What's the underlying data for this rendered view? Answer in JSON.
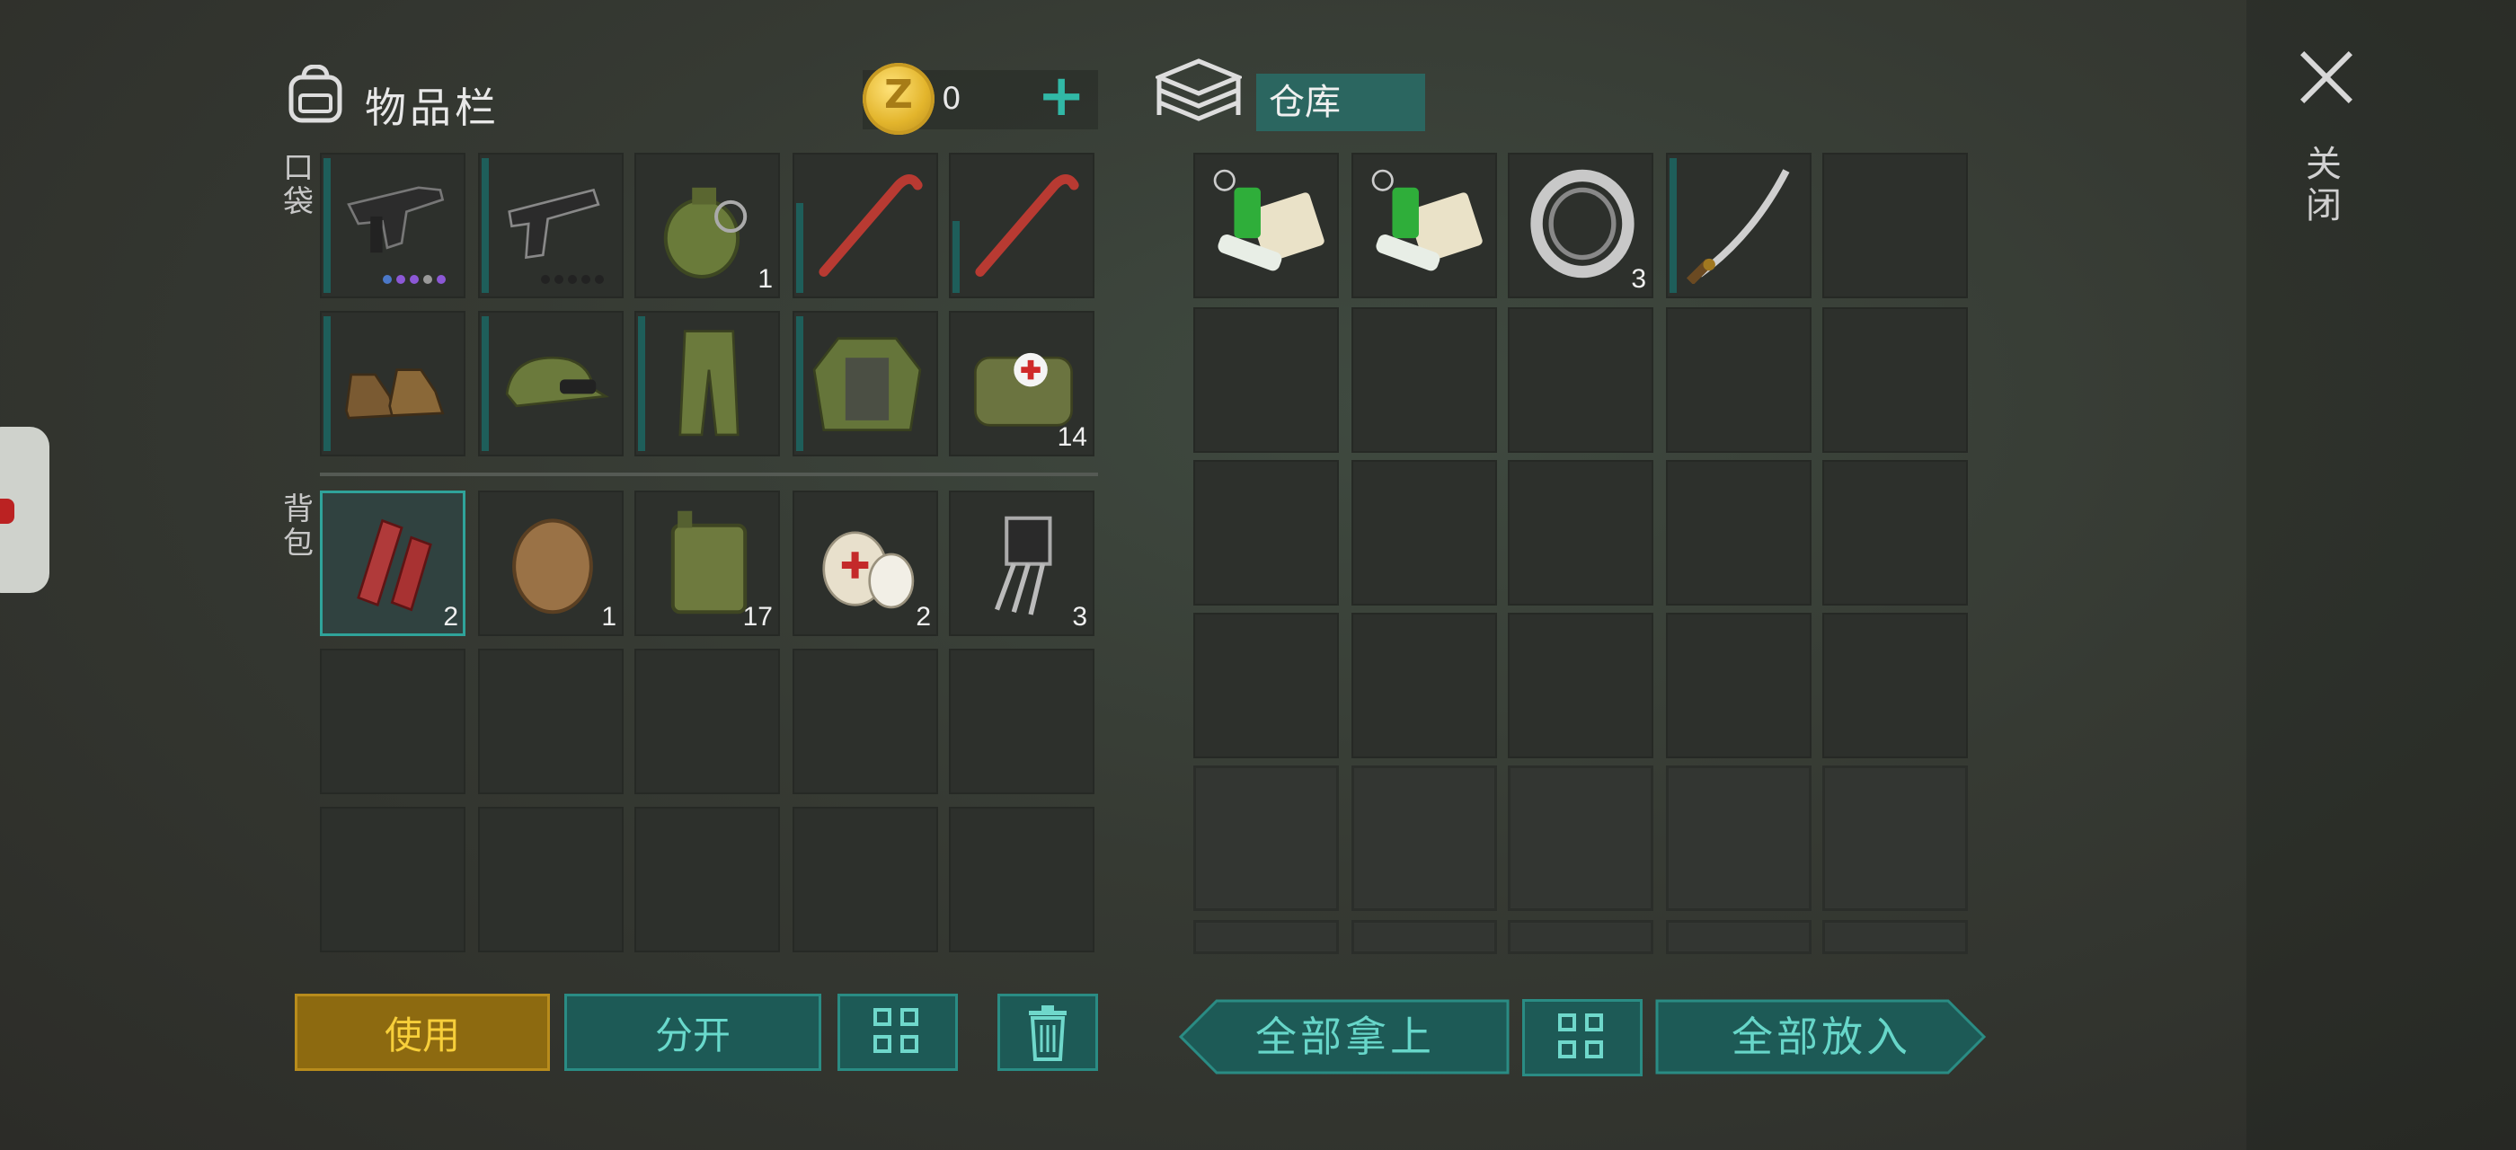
{
  "inventory": {
    "title": "物品栏",
    "coins": "0",
    "add_label": "+"
  },
  "sections": {
    "pockets": "口袋",
    "backpack": "背包"
  },
  "pocket_items": [
    {
      "name": "uzi",
      "qty": ""
    },
    {
      "name": "pistol",
      "qty": ""
    },
    {
      "name": "grenade",
      "qty": "1"
    },
    {
      "name": "crowbar",
      "qty": ""
    },
    {
      "name": "crowbar",
      "qty": ""
    },
    {
      "name": "boots",
      "qty": ""
    },
    {
      "name": "camo-cap",
      "qty": ""
    },
    {
      "name": "camo-pants",
      "qty": ""
    },
    {
      "name": "armored-jacket",
      "qty": ""
    },
    {
      "name": "medkit-bag",
      "qty": "14"
    }
  ],
  "backpack_items": [
    {
      "name": "raw-meat",
      "qty": "2"
    },
    {
      "name": "fur",
      "qty": "1"
    },
    {
      "name": "jerrycan",
      "qty": "17"
    },
    {
      "name": "bandage",
      "qty": "2"
    },
    {
      "name": "transistor",
      "qty": "3"
    }
  ],
  "storage": {
    "title": "仓库",
    "items": [
      {
        "name": "medicine-kit",
        "qty": ""
      },
      {
        "name": "medicine-kit",
        "qty": ""
      },
      {
        "name": "bearing",
        "qty": "3"
      },
      {
        "name": "katana",
        "qty": ""
      }
    ]
  },
  "buttons": {
    "use": "使用",
    "split": "分开",
    "take_all": "全部拿上",
    "put_all": "全部放入"
  },
  "close_label": "关闭",
  "colors": {
    "accent": "#2fa39a",
    "use_button": "#8d6a10"
  }
}
